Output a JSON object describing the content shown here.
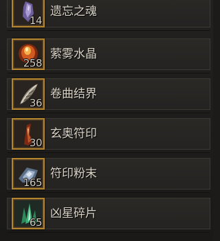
{
  "items": [
    {
      "name": "遗忘之魂",
      "count": "14",
      "icon": "soul-crystal-icon",
      "color": "#7a6aa8"
    },
    {
      "name": "萦雾水晶",
      "count": "258",
      "icon": "mist-crystal-icon",
      "color": "#d2591f"
    },
    {
      "name": "卷曲结界",
      "count": "36",
      "icon": "feather-barrier-icon",
      "color": "#b8b0a0"
    },
    {
      "name": "玄奥符印",
      "count": "30",
      "icon": "arcane-sigil-icon",
      "color": "#9a3a1a"
    },
    {
      "name": "符印粉末",
      "count": "165",
      "icon": "sigil-dust-icon",
      "color": "#8aa0b8"
    },
    {
      "name": "凶星碎片",
      "count": "65",
      "icon": "star-shard-icon",
      "color": "#3fb07a"
    }
  ]
}
